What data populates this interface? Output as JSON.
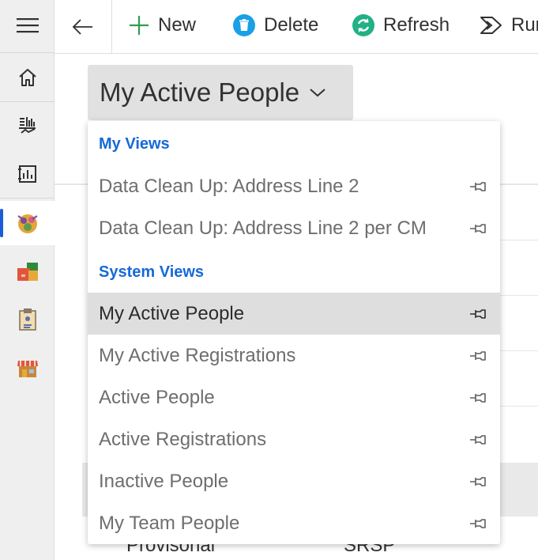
{
  "command_bar": {
    "back_icon": "back-arrow-icon",
    "buttons": [
      {
        "label": "New",
        "icon": "plus-icon",
        "color": "#2e9e52"
      },
      {
        "label": "Delete",
        "icon": "delete-icon",
        "color": "#1aa0e6"
      },
      {
        "label": "Refresh",
        "icon": "refresh-icon",
        "color": "#22b085"
      },
      {
        "label": "Run",
        "icon": "flow-icon"
      }
    ]
  },
  "nav": {
    "items": [
      "hamburger-icon",
      "home-icon",
      "dashboard-icon",
      "reports-icon",
      "people-icon",
      "folders-icon",
      "clipboard-icon",
      "store-icon"
    ],
    "active_color": "#1d5bd8"
  },
  "view_selector": {
    "title": "My Active People",
    "icon": "chevron-down-icon"
  },
  "dropdown": {
    "header_color": "#1669d8",
    "my_views_header": "My Views",
    "my_views": [
      {
        "label": "Data Clean Up: Address Line 2"
      },
      {
        "label": "Data Clean Up: Address Line 2 per CM"
      }
    ],
    "system_views_header": "System Views",
    "system_views": [
      {
        "label": "My Active People",
        "selected": true
      },
      {
        "label": "My Active Registrations"
      },
      {
        "label": "Active People"
      },
      {
        "label": "Active Registrations"
      },
      {
        "label": "Inactive People"
      },
      {
        "label": "My Team People"
      }
    ]
  },
  "background": {
    "row_texts": [
      "Provisonal",
      "SRSP"
    ]
  }
}
